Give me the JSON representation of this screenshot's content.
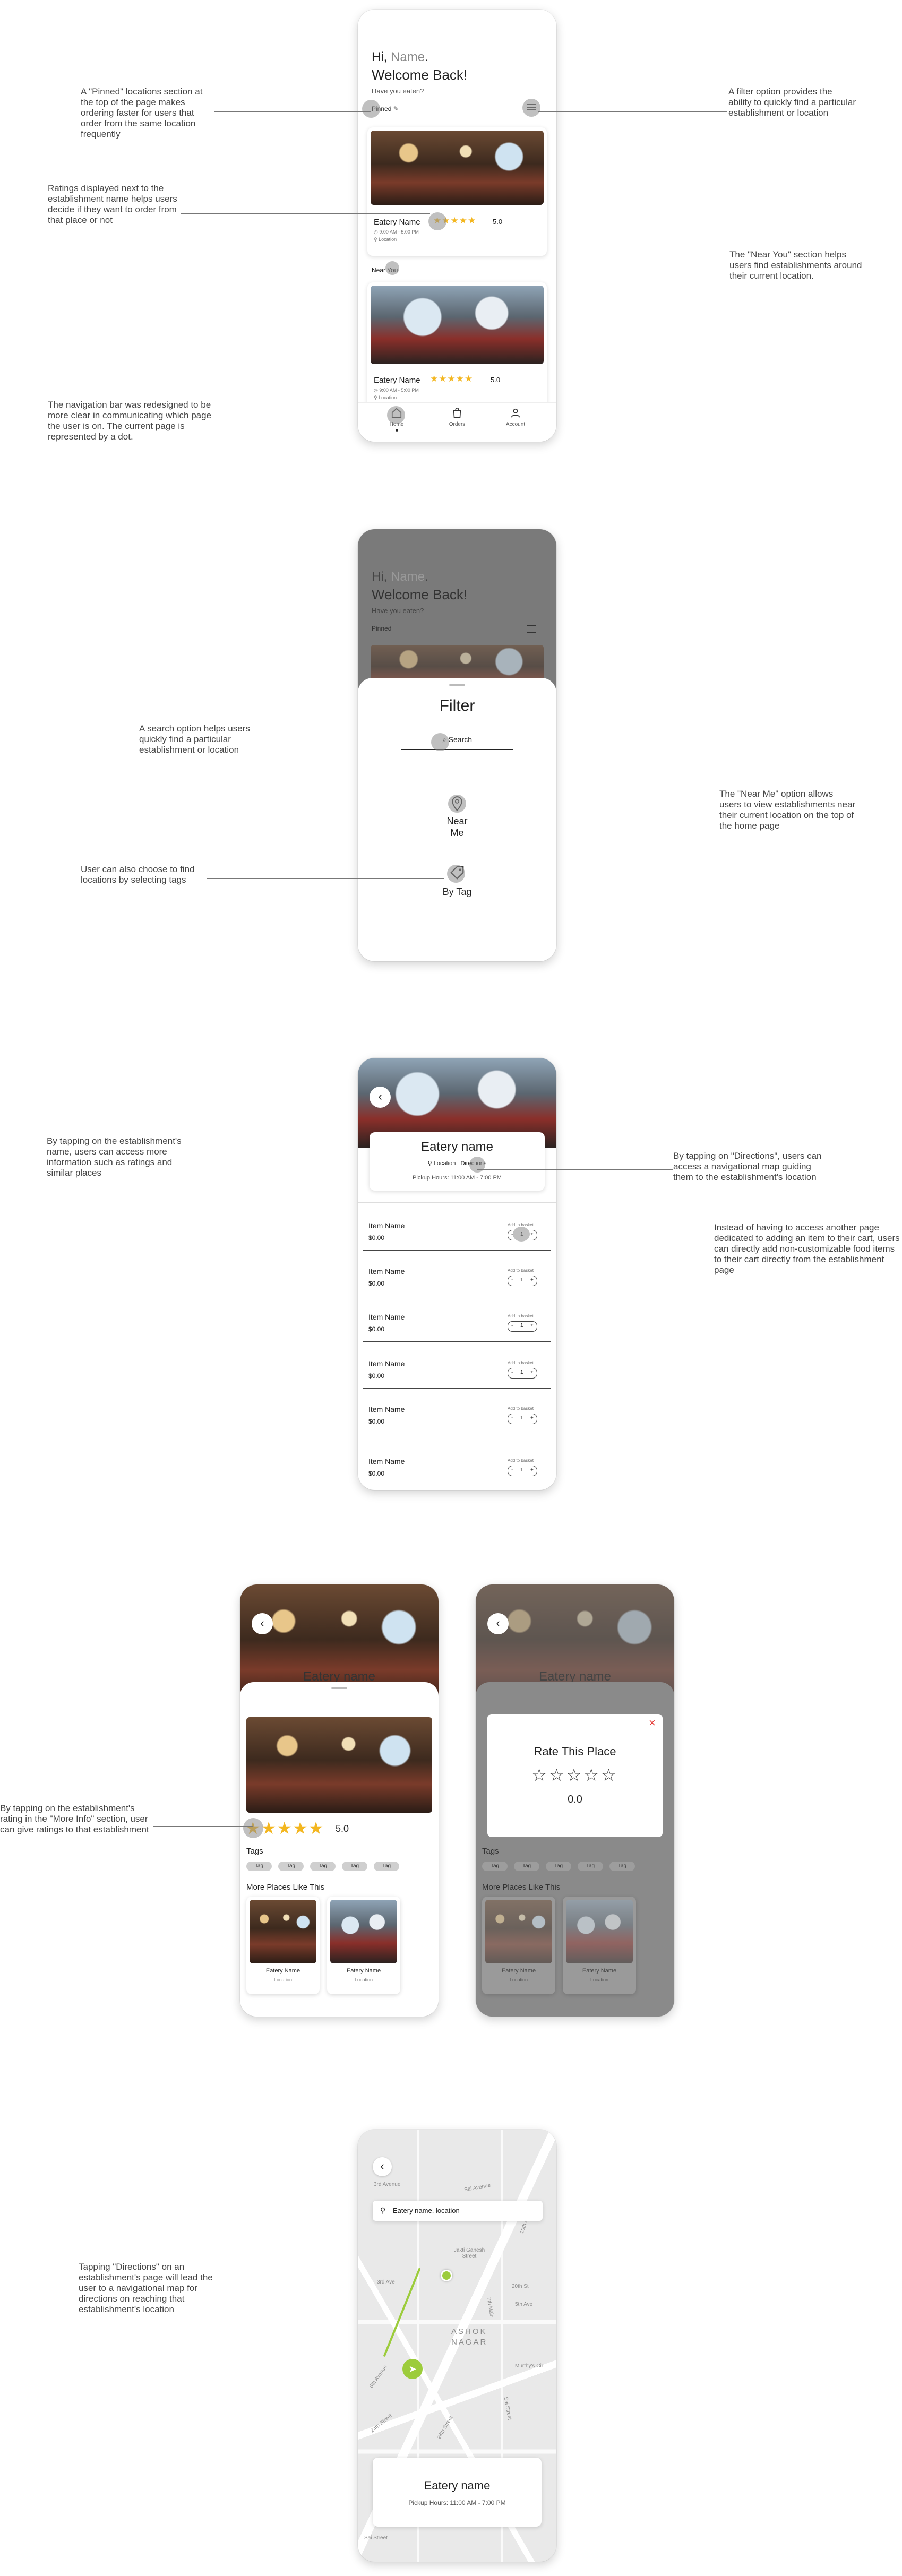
{
  "annotations": {
    "pinned": "A \"Pinned\" locations section at the top of the page makes ordering faster for users that order from the same location frequently",
    "ratings": "Ratings displayed next to the establishment name helps users decide if they want to order from that place or not",
    "navbar": "The navigation bar was redesigned to be more clear in communicating which page the user is on. The current page is represented by a dot.",
    "filter": "A filter option provides the ability to quickly find a particular establishment or location",
    "near_you": "The \"Near You\" section helps users find establishments around their current location.",
    "search": "A search option helps users quickly find a particular establishment or location",
    "near_me": "The \"Near Me\" option allows users to view establishments near their current location on the top of the home page",
    "by_tag": "User can also choose to find locations by selecting tags",
    "name_info": "By tapping on the establishment's name, users can access more information such as ratings and similar places",
    "directions": "By tapping on \"Directions\", users can access a navigational map guiding them to the establishment's location",
    "add_cart": "Instead of having to access another page dedicated to adding an item to their cart, users can directly add non-customizable food items to their cart directly from the establishment page",
    "rating_tap": "By tapping on the establishment's rating in the \"More Info\" section, user can give ratings to that establishment",
    "map": "Tapping \"Directions\" on an establishment's page will lead the user to a navigational map for directions on reaching that establishment's location"
  },
  "home": {
    "greeting_hi": "Hi,",
    "greeting_name": "Name",
    "greeting_dot": ".",
    "welcome": "Welcome Back!",
    "subtitle": "Have you eaten?",
    "pinned_label": "Pinned",
    "near_you_label": "Near You",
    "card1": {
      "name": "Eatery Name",
      "stars": "★★★★★",
      "rating": "5.0",
      "hours": "9:00 AM - 5:00 PM",
      "location": "Location"
    },
    "card2": {
      "name": "Eatery Name",
      "stars": "★★★★★",
      "rating": "5.0",
      "hours": "9:00 AM - 5:00 PM",
      "location": "Location"
    },
    "nav": [
      {
        "label": "Home"
      },
      {
        "label": "Orders"
      },
      {
        "label": "Account"
      }
    ]
  },
  "filter": {
    "title": "Filter",
    "search_placeholder": "Search",
    "near_me": "Near Me",
    "by_tag": "By Tag"
  },
  "eatery": {
    "name": "Eatery name",
    "location": "Location",
    "directions": "Directions",
    "pickup": "Pickup Hours: 11:00 AM - 7:00 PM",
    "add_to_basket": "Add to basket",
    "items": [
      {
        "name": "Item Name",
        "price": "$0.00",
        "qty": "1"
      },
      {
        "name": "Item Name",
        "price": "$0.00",
        "qty": "1"
      },
      {
        "name": "Item Name",
        "price": "$0.00",
        "qty": "1"
      },
      {
        "name": "Item Name",
        "price": "$0.00",
        "qty": "1"
      },
      {
        "name": "Item Name",
        "price": "$0.00",
        "qty": "1"
      },
      {
        "name": "Item Name",
        "price": "$0.00",
        "qty": "1"
      }
    ]
  },
  "moreinfo": {
    "title": "Eatery name",
    "stars": "★★★★★",
    "rating": "5.0",
    "tags_label": "Tags",
    "tags": [
      "Tag",
      "Tag",
      "Tag",
      "Tag",
      "Tag"
    ],
    "more_places": "More Places Like This",
    "places": [
      {
        "name": "Eatery Name",
        "location": "Location"
      },
      {
        "name": "Eatery Name",
        "location": "Location"
      }
    ]
  },
  "rate": {
    "title": "Rate This Place",
    "stars": "☆☆☆☆☆",
    "value": "0.0",
    "close": "×"
  },
  "map": {
    "search_value": "Eatery name, location",
    "eatery": "Eatery name",
    "pickup": "Pickup Hours: 11:00 AM - 7:00 PM",
    "streets": [
      "3rd Avenue",
      "Sai Avenue",
      "Jakti Ganesh Street",
      "3rd Ave",
      "20th St",
      "5th Ave",
      "ASHOK",
      "NAGAR",
      "Murthy's Cir",
      "7th Main",
      "6th Avenue",
      "10th Ave",
      "24th Street",
      "28th Street",
      "Sai Street",
      "Sai Street"
    ]
  },
  "colors": {
    "star": "#f3b61f",
    "map_marker": "#9ccc3c",
    "close": "#e53935",
    "overlay": "#7a7a7a"
  }
}
